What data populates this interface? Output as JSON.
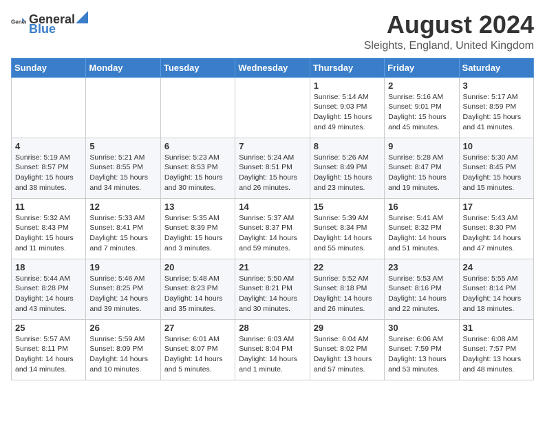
{
  "header": {
    "logo_general": "General",
    "logo_blue": "Blue",
    "title": "August 2024",
    "subtitle": "Sleights, England, United Kingdom"
  },
  "days_of_week": [
    "Sunday",
    "Monday",
    "Tuesday",
    "Wednesday",
    "Thursday",
    "Friday",
    "Saturday"
  ],
  "weeks": [
    [
      {
        "day": "",
        "sunrise": "",
        "sunset": "",
        "daylight": ""
      },
      {
        "day": "",
        "sunrise": "",
        "sunset": "",
        "daylight": ""
      },
      {
        "day": "",
        "sunrise": "",
        "sunset": "",
        "daylight": ""
      },
      {
        "day": "",
        "sunrise": "",
        "sunset": "",
        "daylight": ""
      },
      {
        "day": "1",
        "sunrise": "Sunrise: 5:14 AM",
        "sunset": "Sunset: 9:03 PM",
        "daylight": "Daylight: 15 hours and 49 minutes."
      },
      {
        "day": "2",
        "sunrise": "Sunrise: 5:16 AM",
        "sunset": "Sunset: 9:01 PM",
        "daylight": "Daylight: 15 hours and 45 minutes."
      },
      {
        "day": "3",
        "sunrise": "Sunrise: 5:17 AM",
        "sunset": "Sunset: 8:59 PM",
        "daylight": "Daylight: 15 hours and 41 minutes."
      }
    ],
    [
      {
        "day": "4",
        "sunrise": "Sunrise: 5:19 AM",
        "sunset": "Sunset: 8:57 PM",
        "daylight": "Daylight: 15 hours and 38 minutes."
      },
      {
        "day": "5",
        "sunrise": "Sunrise: 5:21 AM",
        "sunset": "Sunset: 8:55 PM",
        "daylight": "Daylight: 15 hours and 34 minutes."
      },
      {
        "day": "6",
        "sunrise": "Sunrise: 5:23 AM",
        "sunset": "Sunset: 8:53 PM",
        "daylight": "Daylight: 15 hours and 30 minutes."
      },
      {
        "day": "7",
        "sunrise": "Sunrise: 5:24 AM",
        "sunset": "Sunset: 8:51 PM",
        "daylight": "Daylight: 15 hours and 26 minutes."
      },
      {
        "day": "8",
        "sunrise": "Sunrise: 5:26 AM",
        "sunset": "Sunset: 8:49 PM",
        "daylight": "Daylight: 15 hours and 23 minutes."
      },
      {
        "day": "9",
        "sunrise": "Sunrise: 5:28 AM",
        "sunset": "Sunset: 8:47 PM",
        "daylight": "Daylight: 15 hours and 19 minutes."
      },
      {
        "day": "10",
        "sunrise": "Sunrise: 5:30 AM",
        "sunset": "Sunset: 8:45 PM",
        "daylight": "Daylight: 15 hours and 15 minutes."
      }
    ],
    [
      {
        "day": "11",
        "sunrise": "Sunrise: 5:32 AM",
        "sunset": "Sunset: 8:43 PM",
        "daylight": "Daylight: 15 hours and 11 minutes."
      },
      {
        "day": "12",
        "sunrise": "Sunrise: 5:33 AM",
        "sunset": "Sunset: 8:41 PM",
        "daylight": "Daylight: 15 hours and 7 minutes."
      },
      {
        "day": "13",
        "sunrise": "Sunrise: 5:35 AM",
        "sunset": "Sunset: 8:39 PM",
        "daylight": "Daylight: 15 hours and 3 minutes."
      },
      {
        "day": "14",
        "sunrise": "Sunrise: 5:37 AM",
        "sunset": "Sunset: 8:37 PM",
        "daylight": "Daylight: 14 hours and 59 minutes."
      },
      {
        "day": "15",
        "sunrise": "Sunrise: 5:39 AM",
        "sunset": "Sunset: 8:34 PM",
        "daylight": "Daylight: 14 hours and 55 minutes."
      },
      {
        "day": "16",
        "sunrise": "Sunrise: 5:41 AM",
        "sunset": "Sunset: 8:32 PM",
        "daylight": "Daylight: 14 hours and 51 minutes."
      },
      {
        "day": "17",
        "sunrise": "Sunrise: 5:43 AM",
        "sunset": "Sunset: 8:30 PM",
        "daylight": "Daylight: 14 hours and 47 minutes."
      }
    ],
    [
      {
        "day": "18",
        "sunrise": "Sunrise: 5:44 AM",
        "sunset": "Sunset: 8:28 PM",
        "daylight": "Daylight: 14 hours and 43 minutes."
      },
      {
        "day": "19",
        "sunrise": "Sunrise: 5:46 AM",
        "sunset": "Sunset: 8:25 PM",
        "daylight": "Daylight: 14 hours and 39 minutes."
      },
      {
        "day": "20",
        "sunrise": "Sunrise: 5:48 AM",
        "sunset": "Sunset: 8:23 PM",
        "daylight": "Daylight: 14 hours and 35 minutes."
      },
      {
        "day": "21",
        "sunrise": "Sunrise: 5:50 AM",
        "sunset": "Sunset: 8:21 PM",
        "daylight": "Daylight: 14 hours and 30 minutes."
      },
      {
        "day": "22",
        "sunrise": "Sunrise: 5:52 AM",
        "sunset": "Sunset: 8:18 PM",
        "daylight": "Daylight: 14 hours and 26 minutes."
      },
      {
        "day": "23",
        "sunrise": "Sunrise: 5:53 AM",
        "sunset": "Sunset: 8:16 PM",
        "daylight": "Daylight: 14 hours and 22 minutes."
      },
      {
        "day": "24",
        "sunrise": "Sunrise: 5:55 AM",
        "sunset": "Sunset: 8:14 PM",
        "daylight": "Daylight: 14 hours and 18 minutes."
      }
    ],
    [
      {
        "day": "25",
        "sunrise": "Sunrise: 5:57 AM",
        "sunset": "Sunset: 8:11 PM",
        "daylight": "Daylight: 14 hours and 14 minutes."
      },
      {
        "day": "26",
        "sunrise": "Sunrise: 5:59 AM",
        "sunset": "Sunset: 8:09 PM",
        "daylight": "Daylight: 14 hours and 10 minutes."
      },
      {
        "day": "27",
        "sunrise": "Sunrise: 6:01 AM",
        "sunset": "Sunset: 8:07 PM",
        "daylight": "Daylight: 14 hours and 5 minutes."
      },
      {
        "day": "28",
        "sunrise": "Sunrise: 6:03 AM",
        "sunset": "Sunset: 8:04 PM",
        "daylight": "Daylight: 14 hours and 1 minute."
      },
      {
        "day": "29",
        "sunrise": "Sunrise: 6:04 AM",
        "sunset": "Sunset: 8:02 PM",
        "daylight": "Daylight: 13 hours and 57 minutes."
      },
      {
        "day": "30",
        "sunrise": "Sunrise: 6:06 AM",
        "sunset": "Sunset: 7:59 PM",
        "daylight": "Daylight: 13 hours and 53 minutes."
      },
      {
        "day": "31",
        "sunrise": "Sunrise: 6:08 AM",
        "sunset": "Sunset: 7:57 PM",
        "daylight": "Daylight: 13 hours and 48 minutes."
      }
    ]
  ]
}
